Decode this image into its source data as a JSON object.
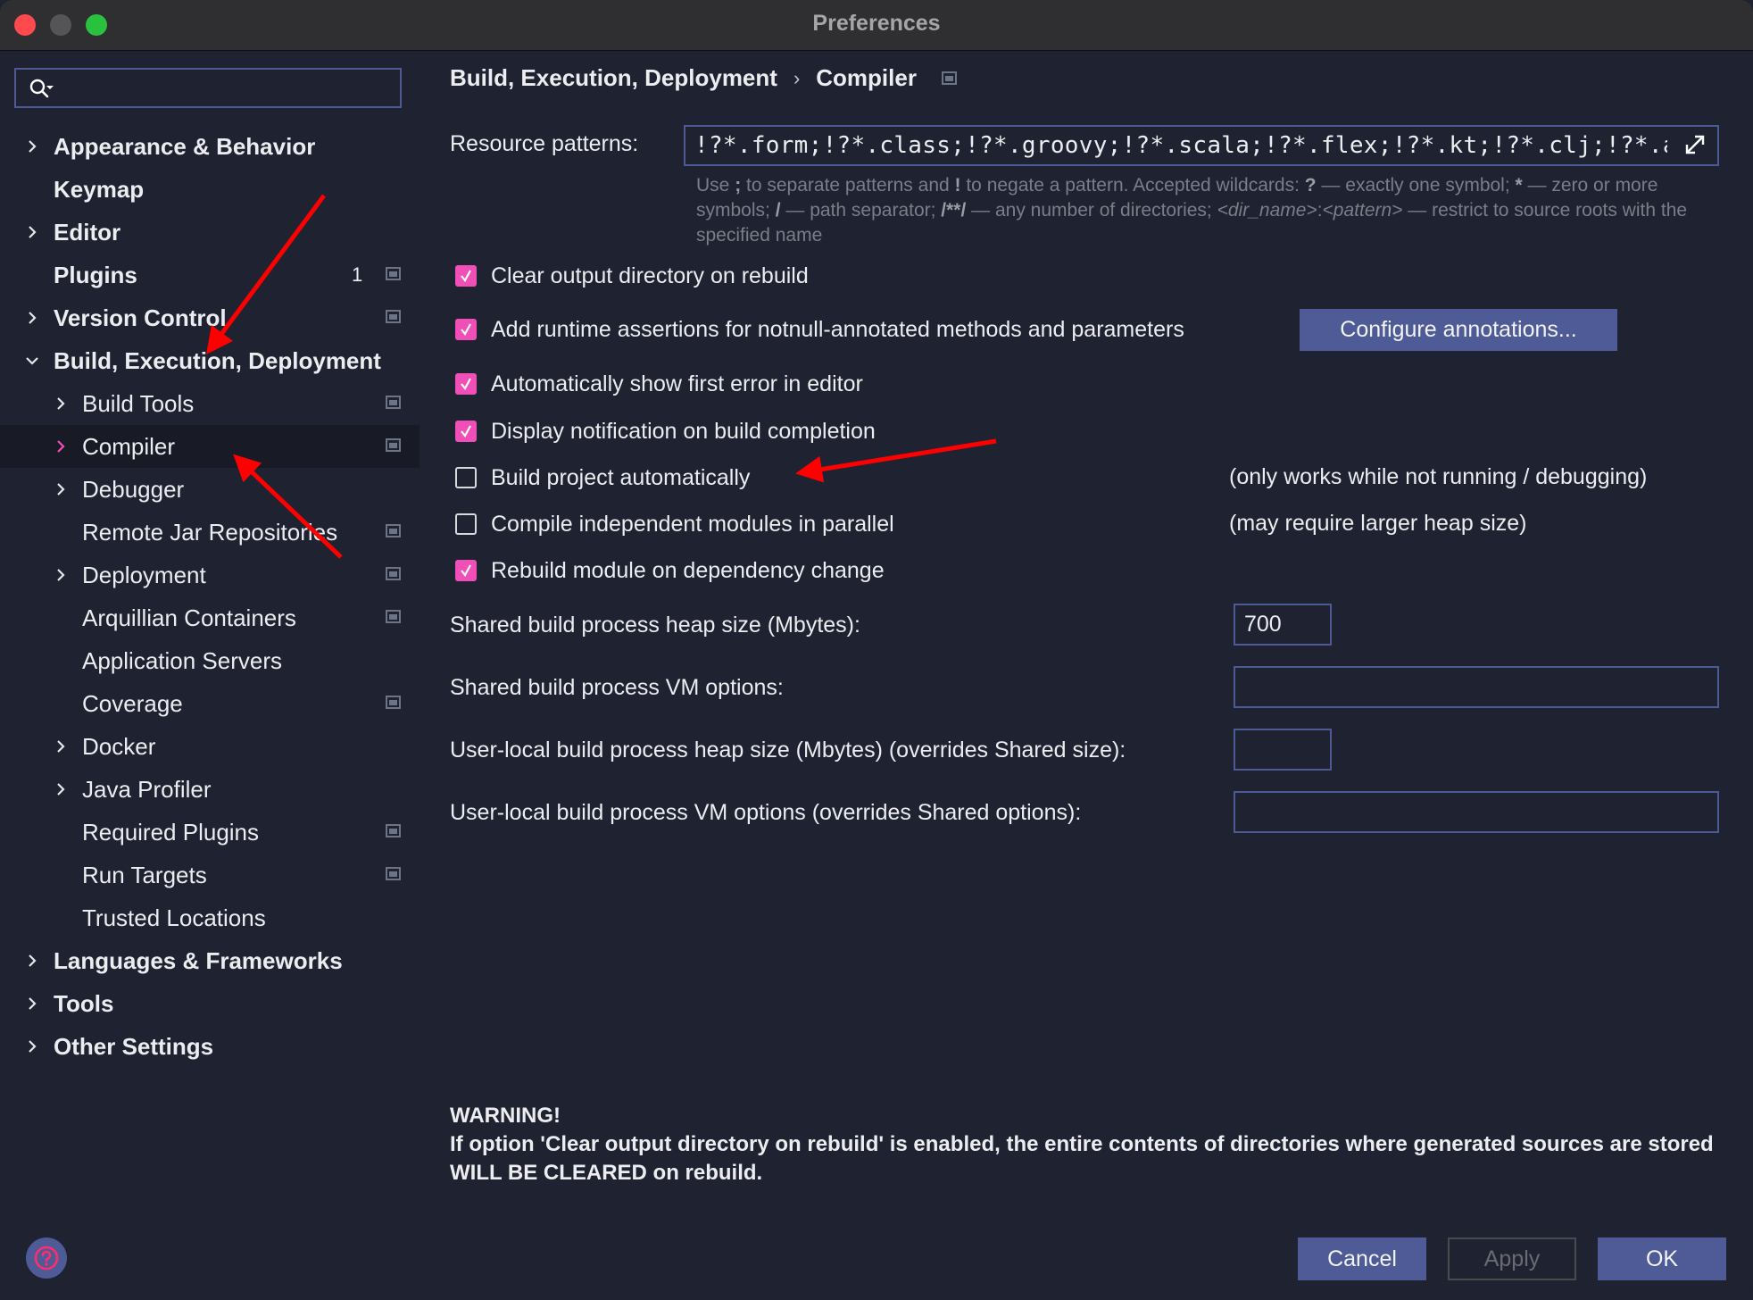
{
  "window": {
    "title": "Preferences"
  },
  "sidebar": {
    "search": {
      "value": "",
      "placeholder": ""
    },
    "items": [
      {
        "label": "Appearance & Behavior",
        "level": 0,
        "expandable": true,
        "expanded": false
      },
      {
        "label": "Keymap",
        "level": 0,
        "expandable": false
      },
      {
        "label": "Editor",
        "level": 0,
        "expandable": true,
        "expanded": false
      },
      {
        "label": "Plugins",
        "level": 0,
        "expandable": false,
        "badge": "1",
        "project_icon": true
      },
      {
        "label": "Version Control",
        "level": 0,
        "expandable": true,
        "expanded": false,
        "project_icon": true
      },
      {
        "label": "Build, Execution, Deployment",
        "level": 0,
        "expandable": true,
        "expanded": true
      },
      {
        "label": "Build Tools",
        "level": 1,
        "expandable": true,
        "project_icon": true
      },
      {
        "label": "Compiler",
        "level": 1,
        "expandable": true,
        "selected": true,
        "project_icon": true
      },
      {
        "label": "Debugger",
        "level": 1,
        "expandable": true
      },
      {
        "label": "Remote Jar Repositories",
        "level": 1,
        "expandable": false,
        "project_icon": true
      },
      {
        "label": "Deployment",
        "level": 1,
        "expandable": true,
        "project_icon": true
      },
      {
        "label": "Arquillian Containers",
        "level": 1,
        "expandable": false,
        "project_icon": true
      },
      {
        "label": "Application Servers",
        "level": 1,
        "expandable": false
      },
      {
        "label": "Coverage",
        "level": 1,
        "expandable": false,
        "project_icon": true
      },
      {
        "label": "Docker",
        "level": 1,
        "expandable": true
      },
      {
        "label": "Java Profiler",
        "level": 1,
        "expandable": true
      },
      {
        "label": "Required Plugins",
        "level": 1,
        "expandable": false,
        "project_icon": true
      },
      {
        "label": "Run Targets",
        "level": 1,
        "expandable": false,
        "project_icon": true
      },
      {
        "label": "Trusted Locations",
        "level": 1,
        "expandable": false
      },
      {
        "label": "Languages & Frameworks",
        "level": 0,
        "expandable": true,
        "expanded": false
      },
      {
        "label": "Tools",
        "level": 0,
        "expandable": true,
        "expanded": false
      },
      {
        "label": "Other Settings",
        "level": 0,
        "expandable": true,
        "expanded": false
      }
    ]
  },
  "breadcrumb": {
    "parent": "Build, Execution, Deployment",
    "separator": "›",
    "current": "Compiler"
  },
  "resource_patterns": {
    "label": "Resource patterns:",
    "value": "!?*.form;!?*.class;!?*.groovy;!?*.scala;!?*.flex;!?*.kt;!?*.clj;!?*.aj",
    "hint": {
      "p1": "Use ",
      "b1": ";",
      "p2": " to separate patterns and ",
      "b2": "!",
      "p3": " to negate a pattern. Accepted wildcards: ",
      "b3": "?",
      "p4": " — exactly one symbol; ",
      "b4": "*",
      "p5": " — zero or more symbols; ",
      "b5": "/",
      "p6": " — path separator; ",
      "b6": "/**/",
      "p7": " — any number of directories; ",
      "i1": "<dir_name>",
      "p8": ":",
      "i2": "<pattern>",
      "p9": " — restrict to source roots with the specified name"
    }
  },
  "options": [
    {
      "label": "Clear output directory on rebuild",
      "checked": true
    },
    {
      "label": "Add runtime assertions for notnull-annotated methods and parameters",
      "checked": true
    },
    {
      "label": "Automatically show first error in editor",
      "checked": true
    },
    {
      "label": "Display notification on build completion",
      "checked": true
    },
    {
      "label": "Build project automatically",
      "checked": false,
      "note": "(only works while not running / debugging)"
    },
    {
      "label": "Compile independent modules in parallel",
      "checked": false,
      "note": "(may require larger heap size)"
    },
    {
      "label": "Rebuild module on dependency change",
      "checked": true
    }
  ],
  "configure_annotations_label": "Configure annotations...",
  "fields": [
    {
      "label": "Shared build process heap size (Mbytes):",
      "value": "700"
    },
    {
      "label": "Shared build process VM options:",
      "value": ""
    },
    {
      "label": "User-local build process heap size (Mbytes) (overrides Shared size):",
      "value": ""
    },
    {
      "label": "User-local build process VM options (overrides Shared options):",
      "value": ""
    }
  ],
  "warning": {
    "title": "WARNING!",
    "text": "If option 'Clear output directory on rebuild' is enabled, the entire contents of directories where generated sources are stored WILL BE CLEARED on rebuild."
  },
  "buttons": {
    "cancel": "Cancel",
    "apply": "Apply",
    "ok": "OK",
    "apply_enabled": false
  },
  "colors": {
    "background": "#1f2231",
    "accent": "#4e5b96",
    "checkbox_checked": "#f04fb7",
    "selected_chevron": "#f04fb7",
    "annotation_arrow": "#ff0000"
  }
}
